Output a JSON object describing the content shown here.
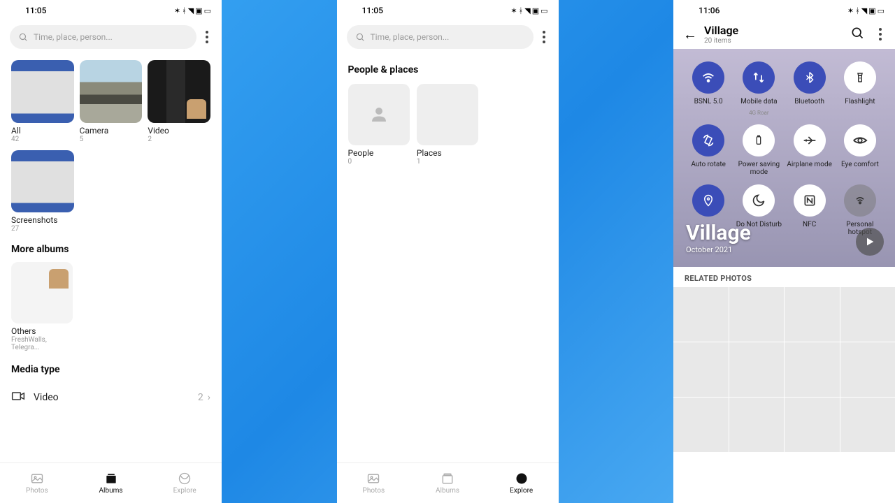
{
  "screen1": {
    "time": "11:05",
    "search_placeholder": "Time, place, person...",
    "albums": [
      {
        "title": "All",
        "count": "42"
      },
      {
        "title": "Camera",
        "count": "5"
      },
      {
        "title": "Video",
        "count": "2"
      },
      {
        "title": "Screenshots",
        "count": "27"
      }
    ],
    "more_albums_label": "More albums",
    "others_title": "Others",
    "others_sub": "FreshWalls, Telegra...",
    "media_type_label": "Media type",
    "video_row_label": "Video",
    "video_row_count": "2",
    "nav": {
      "photos": "Photos",
      "albums": "Albums",
      "explore": "Explore"
    }
  },
  "screen2": {
    "time": "11:05",
    "search_placeholder": "Time, place, person...",
    "section_title": "People & places",
    "people_label": "People",
    "people_count": "0",
    "places_label": "Places",
    "places_count": "1",
    "nav": {
      "photos": "Photos",
      "albums": "Albums",
      "explore": "Explore"
    }
  },
  "screen3": {
    "time": "11:06",
    "title": "Village",
    "subtitle": "20 items",
    "hero_title": "Village",
    "hero_date": "October 2021",
    "related_title": "RELATED PHOTOS",
    "qs": [
      {
        "label": "BSNL 5.0",
        "sub": "",
        "on": true,
        "arrow": true
      },
      {
        "label": "Mobile data",
        "sub": "4G    Roar",
        "on": true,
        "arrow": false
      },
      {
        "label": "Bluetooth",
        "sub": "",
        "on": true,
        "arrow": true
      },
      {
        "label": "Flashlight",
        "sub": "",
        "on": false,
        "arrow": false
      },
      {
        "label": "Auto rotate",
        "sub": "",
        "on": true,
        "arrow": false
      },
      {
        "label": "Power saving mode",
        "sub": "",
        "on": false,
        "arrow": false
      },
      {
        "label": "Airplane mode",
        "sub": "",
        "on": false,
        "arrow": false
      },
      {
        "label": "Eye comfort",
        "sub": "",
        "on": false,
        "arrow": false
      },
      {
        "label": "",
        "sub": "",
        "on": true,
        "arrow": false
      },
      {
        "label": "Do Not Disturb",
        "sub": "",
        "on": false,
        "arrow": true
      },
      {
        "label": "NFC",
        "sub": "",
        "on": false,
        "arrow": false
      },
      {
        "label": "Personal hotspot",
        "sub": "",
        "on": false,
        "arrow": true
      }
    ]
  }
}
